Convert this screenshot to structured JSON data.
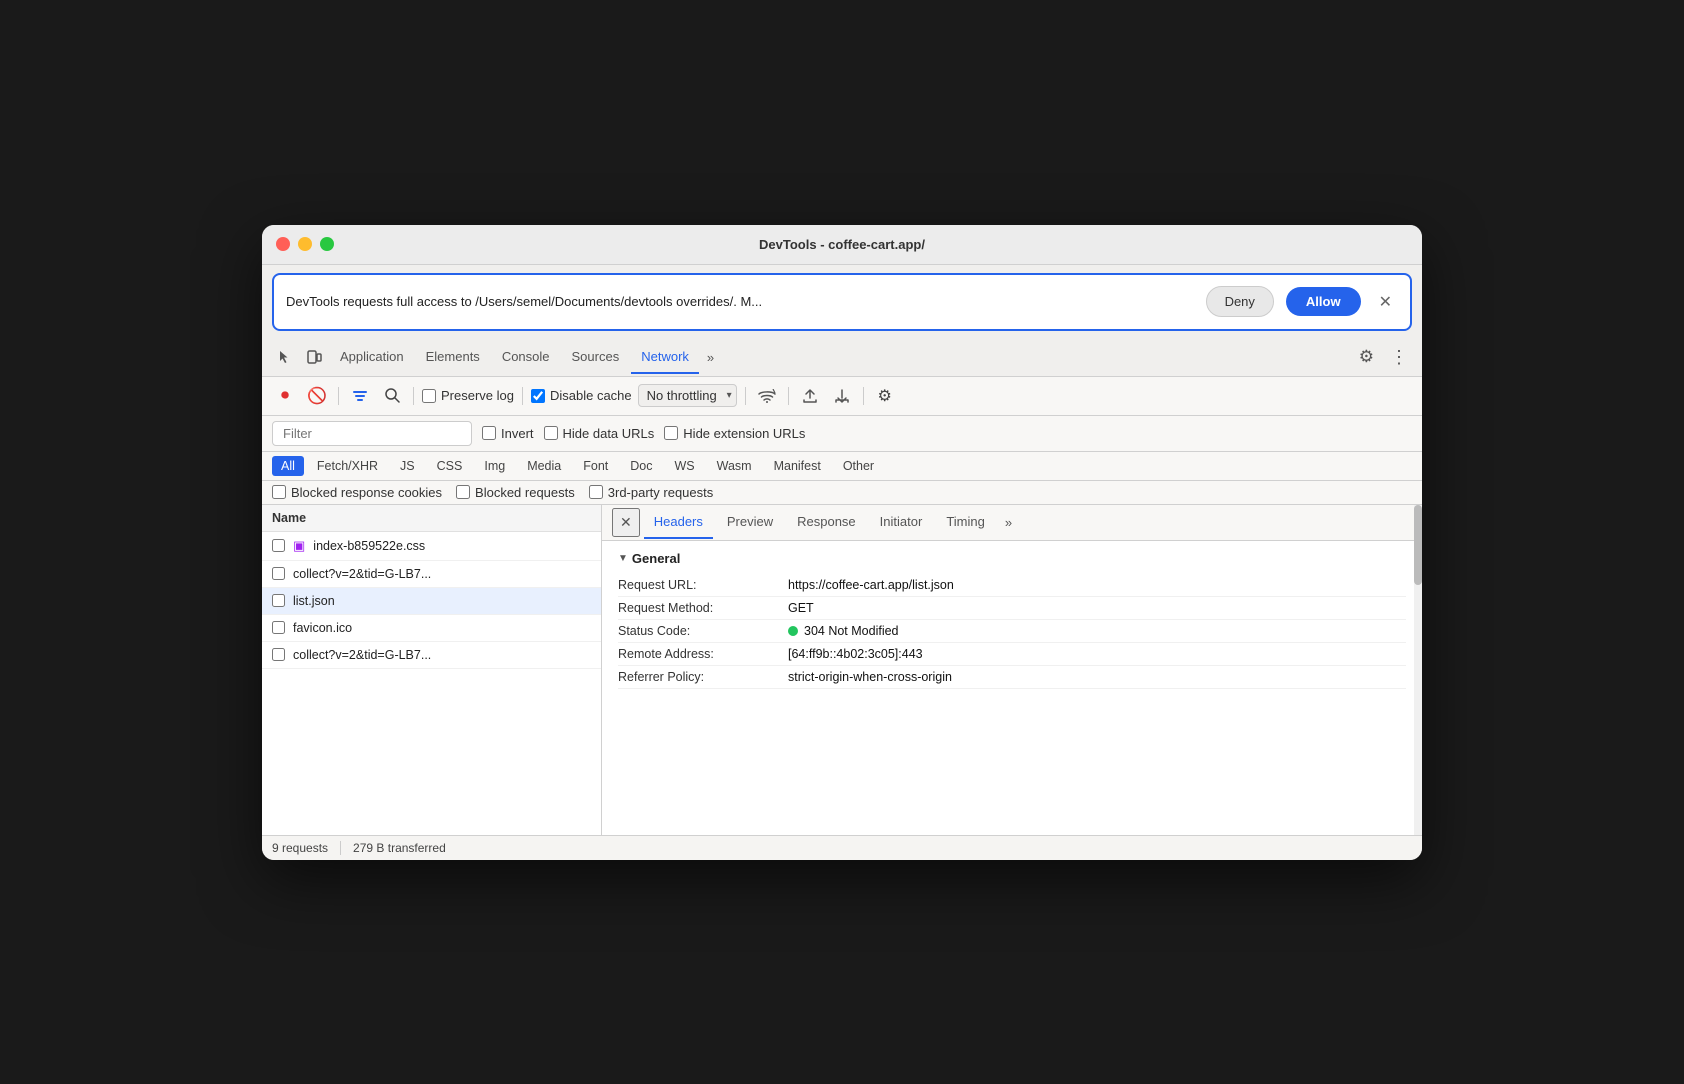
{
  "window": {
    "title": "DevTools - coffee-cart.app/"
  },
  "permission": {
    "text": "DevTools requests full access to /Users/semel/Documents/devtools overrides/. M...",
    "deny_label": "Deny",
    "allow_label": "Allow"
  },
  "tabs": {
    "items": [
      {
        "label": "Application",
        "active": false
      },
      {
        "label": "Elements",
        "active": false
      },
      {
        "label": "Console",
        "active": false
      },
      {
        "label": "Sources",
        "active": false
      },
      {
        "label": "Network",
        "active": true
      }
    ],
    "more": "»"
  },
  "toolbar": {
    "preserve_log_label": "Preserve log",
    "disable_cache_label": "Disable cache",
    "throttle_option": "No throttling"
  },
  "filter": {
    "placeholder": "Filter",
    "invert_label": "Invert",
    "hide_data_urls_label": "Hide data URLs",
    "hide_ext_urls_label": "Hide extension URLs"
  },
  "type_filters": [
    {
      "label": "All",
      "active": true
    },
    {
      "label": "Fetch/XHR",
      "active": false
    },
    {
      "label": "JS",
      "active": false
    },
    {
      "label": "CSS",
      "active": false
    },
    {
      "label": "Img",
      "active": false
    },
    {
      "label": "Media",
      "active": false
    },
    {
      "label": "Font",
      "active": false
    },
    {
      "label": "Doc",
      "active": false
    },
    {
      "label": "WS",
      "active": false
    },
    {
      "label": "Wasm",
      "active": false
    },
    {
      "label": "Manifest",
      "active": false
    },
    {
      "label": "Other",
      "active": false
    }
  ],
  "blocked_row": {
    "blocked_cookies_label": "Blocked response cookies",
    "blocked_requests_label": "Blocked requests",
    "third_party_label": "3rd-party requests"
  },
  "file_list": {
    "header": "Name",
    "items": [
      {
        "name": "index-b859522e.css",
        "icon": "css",
        "selected": false
      },
      {
        "name": "collect?v=2&tid=G-LB7...",
        "icon": "none",
        "selected": false
      },
      {
        "name": "list.json",
        "icon": "none",
        "selected": true
      },
      {
        "name": "favicon.ico",
        "icon": "none",
        "selected": false
      },
      {
        "name": "collect?v=2&tid=G-LB7...",
        "icon": "none",
        "selected": false
      }
    ]
  },
  "detail_tabs": {
    "items": [
      {
        "label": "Headers",
        "active": true
      },
      {
        "label": "Preview",
        "active": false
      },
      {
        "label": "Response",
        "active": false
      },
      {
        "label": "Initiator",
        "active": false
      },
      {
        "label": "Timing",
        "active": false
      }
    ],
    "more": "»"
  },
  "general_section": {
    "title": "General",
    "rows": [
      {
        "key": "Request URL:",
        "val": "https://coffee-cart.app/list.json"
      },
      {
        "key": "Request Method:",
        "val": "GET"
      },
      {
        "key": "Status Code:",
        "val": "304 Not Modified",
        "has_dot": true
      },
      {
        "key": "Remote Address:",
        "val": "[64:ff9b::4b02:3c05]:443"
      },
      {
        "key": "Referrer Policy:",
        "val": "strict-origin-when-cross-origin"
      }
    ]
  },
  "footer": {
    "requests": "9 requests",
    "transferred": "279 B transferred"
  }
}
